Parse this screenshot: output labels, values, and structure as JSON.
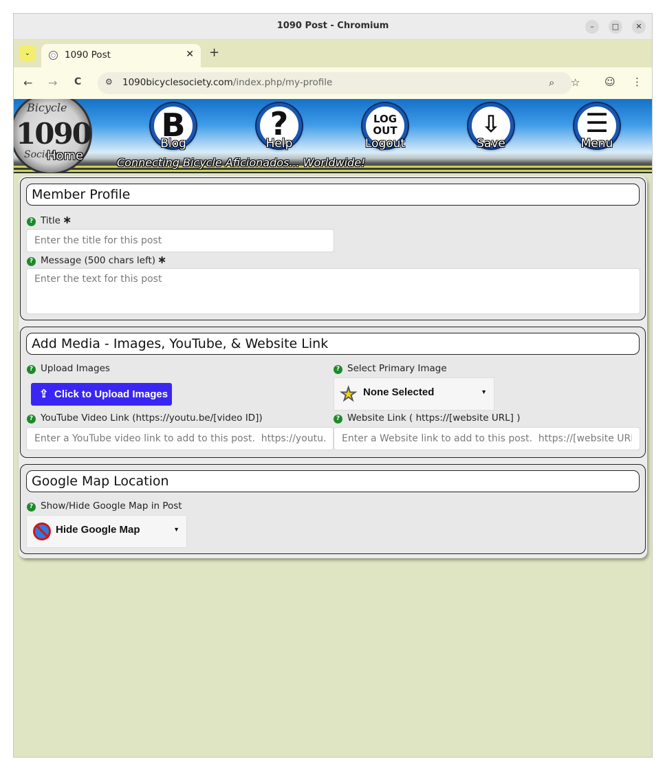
{
  "window": {
    "title": "1090 Post - Chromium",
    "controls": {
      "minimize": "–",
      "maximize": "□",
      "close": "✕"
    }
  },
  "tabs": [
    {
      "title": "1090 Post",
      "close": "✕"
    }
  ],
  "tabstrip": {
    "dropdown": "⌄",
    "new_tab": "+"
  },
  "toolbar": {
    "url_host": "1090bicyclesociety.com",
    "url_path": "/index.php/my-profile",
    "icons": {
      "back": "←",
      "forward": "→",
      "reload": "C",
      "site_info": "⚙",
      "zoom": "⌕",
      "bookmark": "☆",
      "profile": "☺",
      "menu": "⋮"
    }
  },
  "banner": {
    "logo_number": "1090",
    "logo_top_text": "Bicycle",
    "logo_bottom_text": "Society",
    "home_label": "Home",
    "tagline": "Connecting Bicycle Aficionados... Worldwide!",
    "nav": [
      {
        "glyph": "B",
        "label": "Blog"
      },
      {
        "glyph": "?",
        "label": "Help"
      },
      {
        "glyph": "LOG\nOUT",
        "label": "Logout"
      },
      {
        "glyph": "⇩",
        "label": "Save"
      },
      {
        "glyph": "☰",
        "label": "Menu"
      }
    ]
  },
  "member_profile": {
    "heading": "Member Profile",
    "title_label": "Title",
    "title_placeholder": "Enter the title for this post",
    "message_label": "Message (500 chars left)",
    "message_placeholder": "Enter the text for this post",
    "required_mark": "∗"
  },
  "add_media": {
    "heading": "Add Media - Images, YouTube, & Website Link",
    "upload_label": "Upload Images",
    "upload_button": "Click to Upload Images",
    "primary_label": "Select Primary Image",
    "primary_value": "None Selected",
    "youtube_label": "YouTube Video Link (https://youtu.be/[video ID])",
    "youtube_placeholder": "Enter a YouTube video link to add to this post.  https://youtu.be/[video ID]",
    "website_label": "Website Link ( https://[website URL] )",
    "website_placeholder": "Enter a Website link to add to this post.  https://[website URL]"
  },
  "google_map": {
    "heading": "Google Map Location",
    "toggle_label": "Show/Hide Google Map in Post",
    "toggle_value": "Hide Google Map"
  },
  "help_glyph": "?",
  "caret": "▼"
}
